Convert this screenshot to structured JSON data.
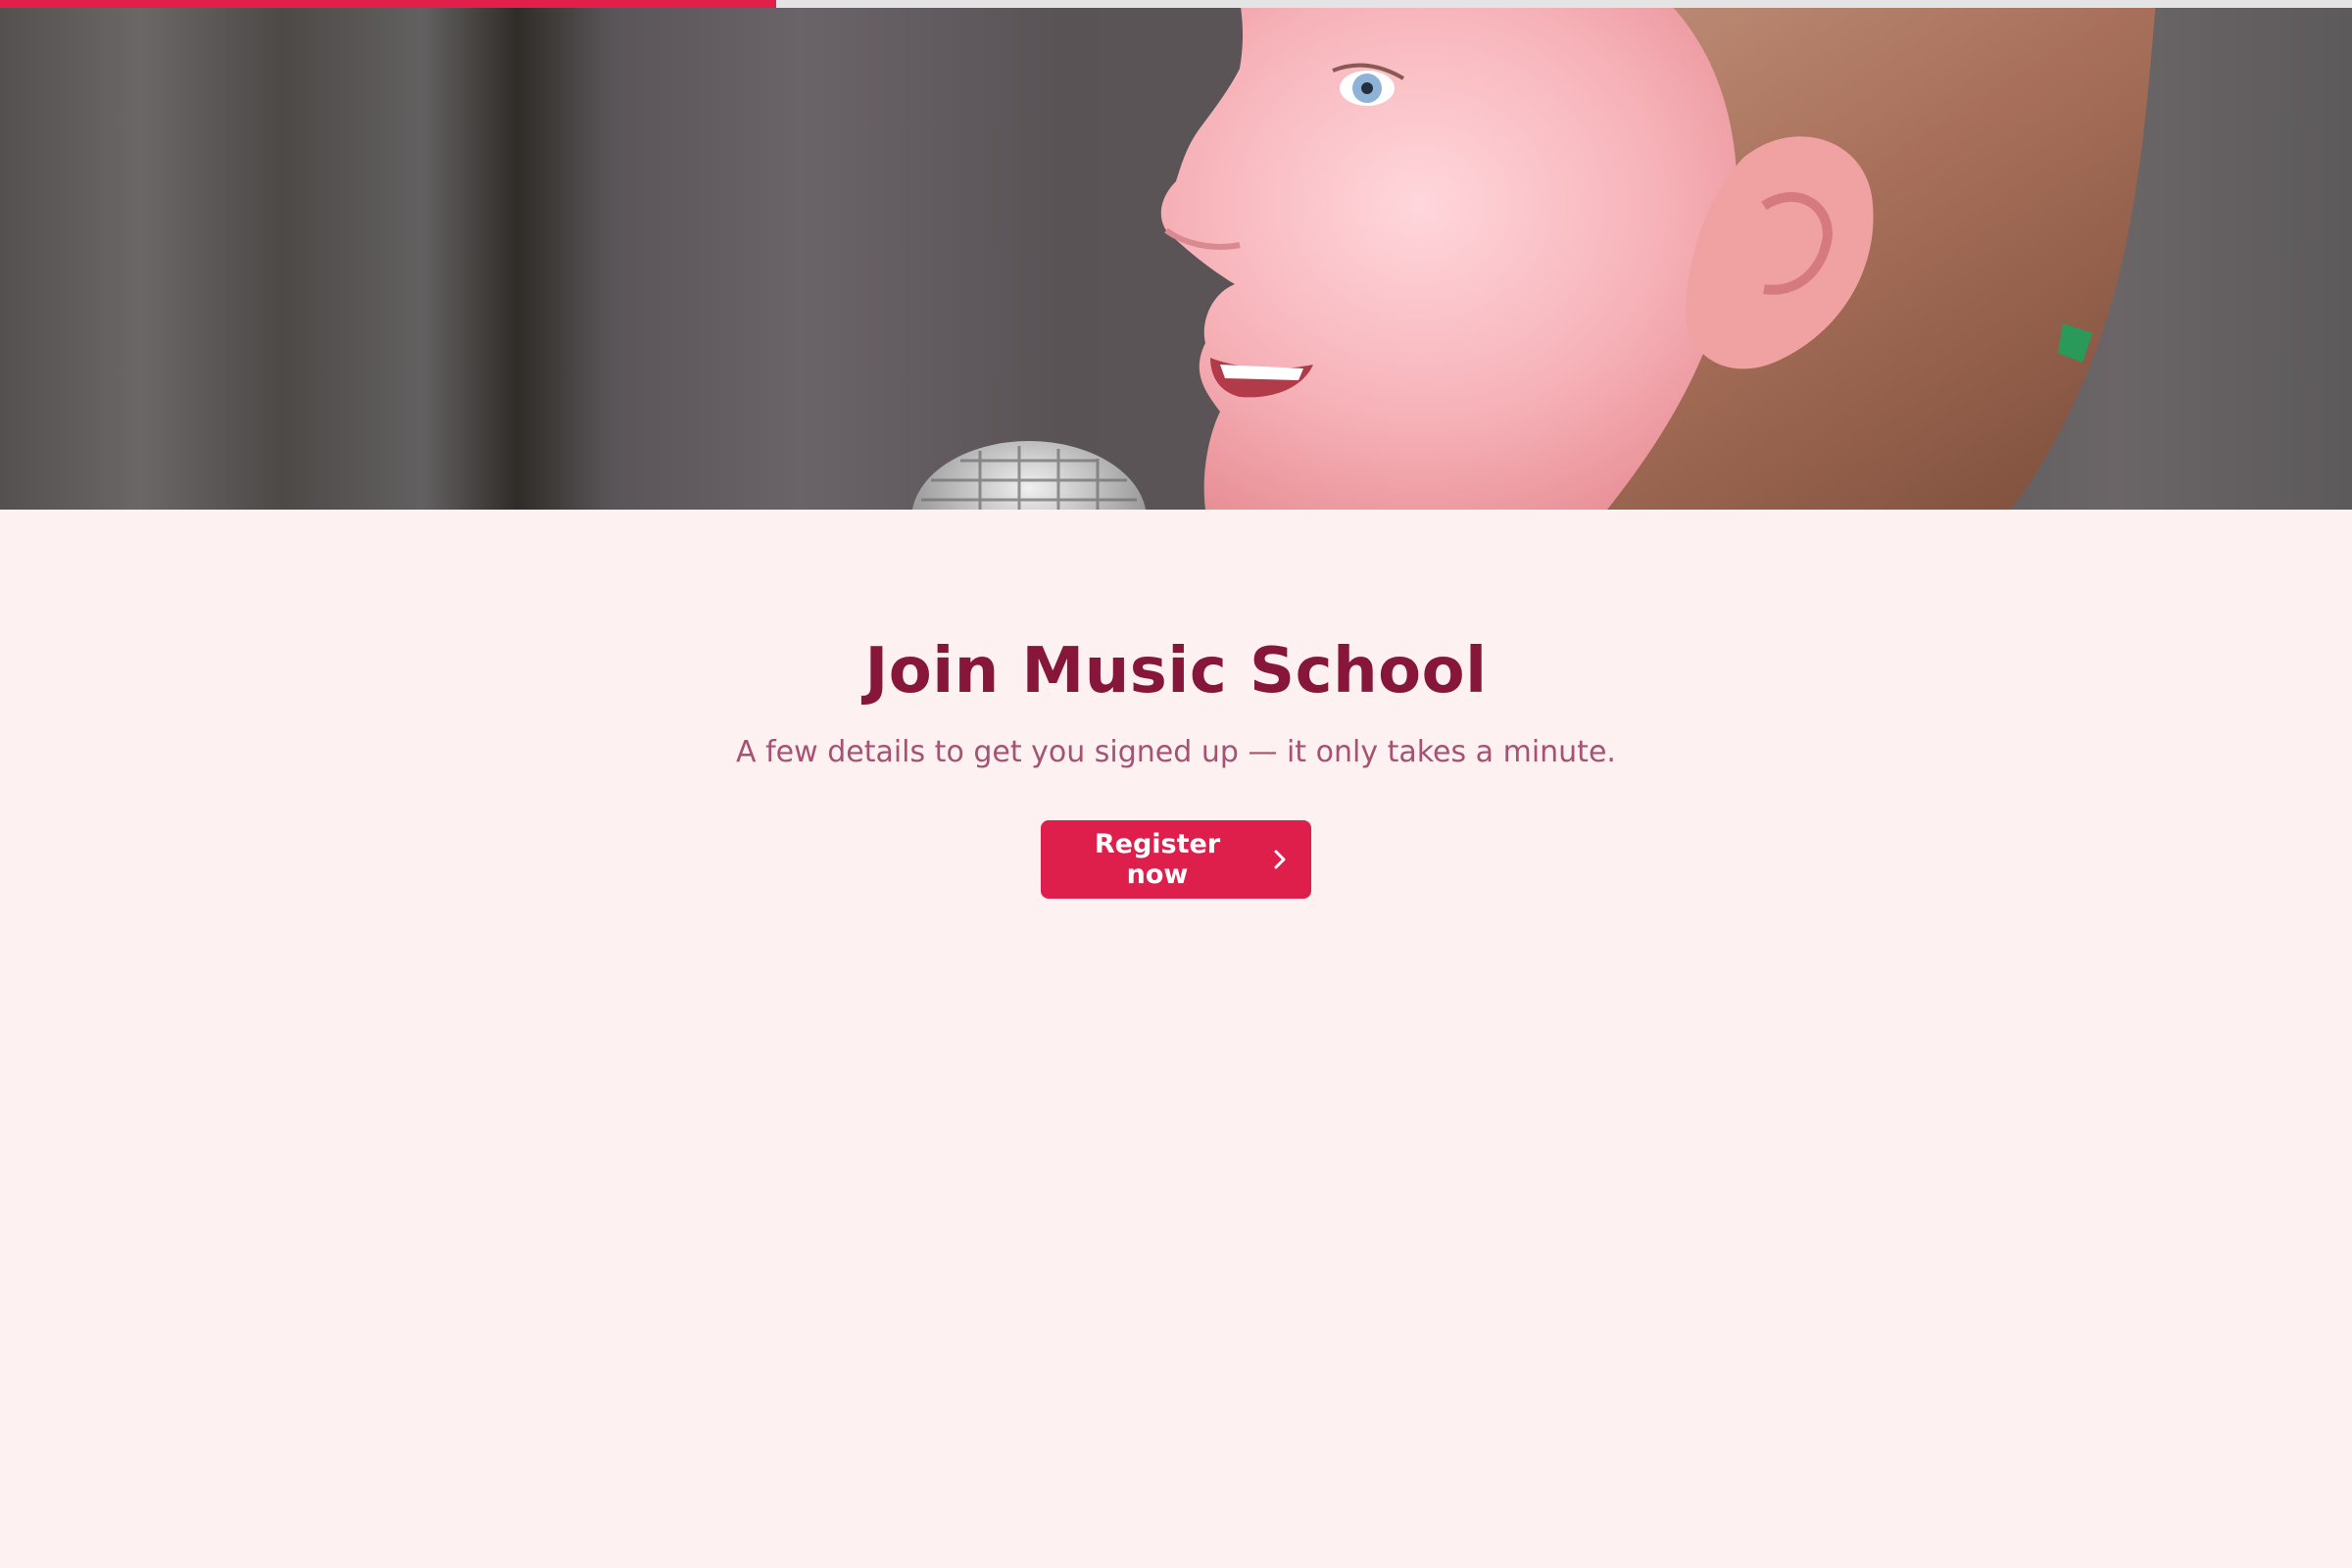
{
  "progress": {
    "fraction": 0.33
  },
  "hero": {
    "image": "child-singing-into-microphone-photo"
  },
  "main": {
    "title": "Join Music School",
    "subtitle": "A few details to get you signed up — it only takes a minute.",
    "register_label": "Register now",
    "register_icon": "chevron-right-icon"
  },
  "colors": {
    "accent": "#de1f4b",
    "title": "#86163a",
    "subtitle": "#a65272",
    "background": "#fdf1f1"
  }
}
